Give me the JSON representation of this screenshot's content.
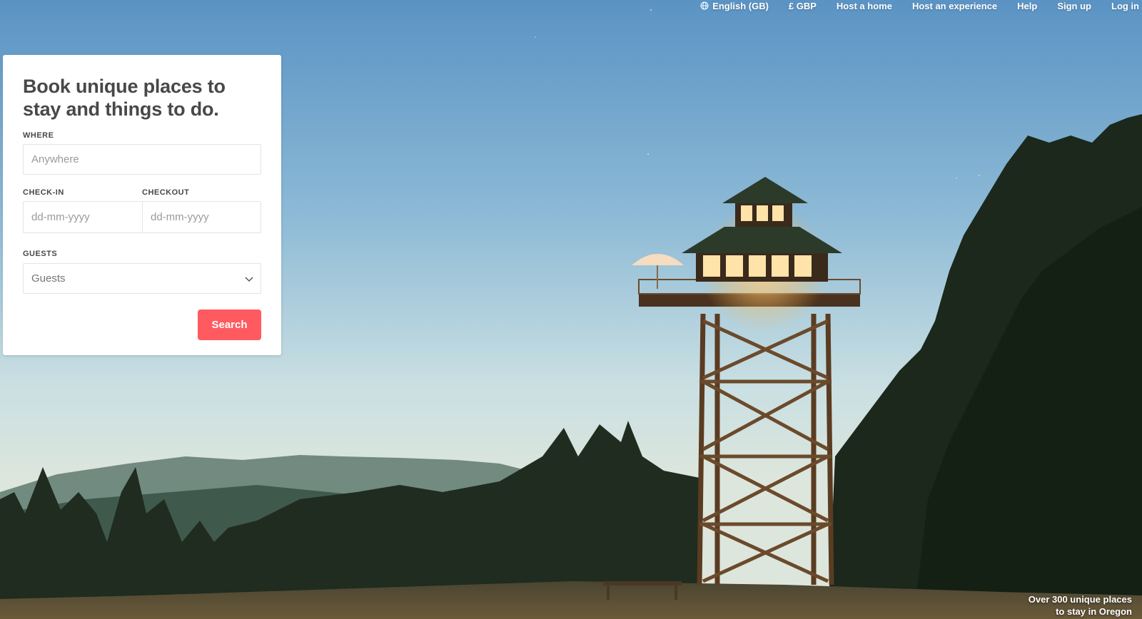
{
  "nav": {
    "language": "English (GB)",
    "currency": "£ GBP",
    "host_home": "Host a home",
    "host_experience": "Host an experience",
    "help": "Help",
    "signup": "Sign up",
    "login": "Log in"
  },
  "search_card": {
    "title": "Book unique places to stay and things to do.",
    "where_label": "WHERE",
    "where_placeholder": "Anywhere",
    "checkin_label": "CHECK-IN",
    "checkin_placeholder": "dd-mm-yyyy",
    "checkout_label": "CHECKOUT",
    "checkout_placeholder": "dd-mm-yyyy",
    "guests_label": "GUESTS",
    "guests_value": "Guests",
    "search_button": "Search"
  },
  "hero_caption": {
    "line1": "Over 300 unique places",
    "line2": "to stay in Oregon"
  },
  "colors": {
    "accent": "#ff5a5f",
    "text": "#484848"
  },
  "icons": {
    "language": "globe-icon",
    "guests_dropdown": "chevron-down-icon"
  }
}
